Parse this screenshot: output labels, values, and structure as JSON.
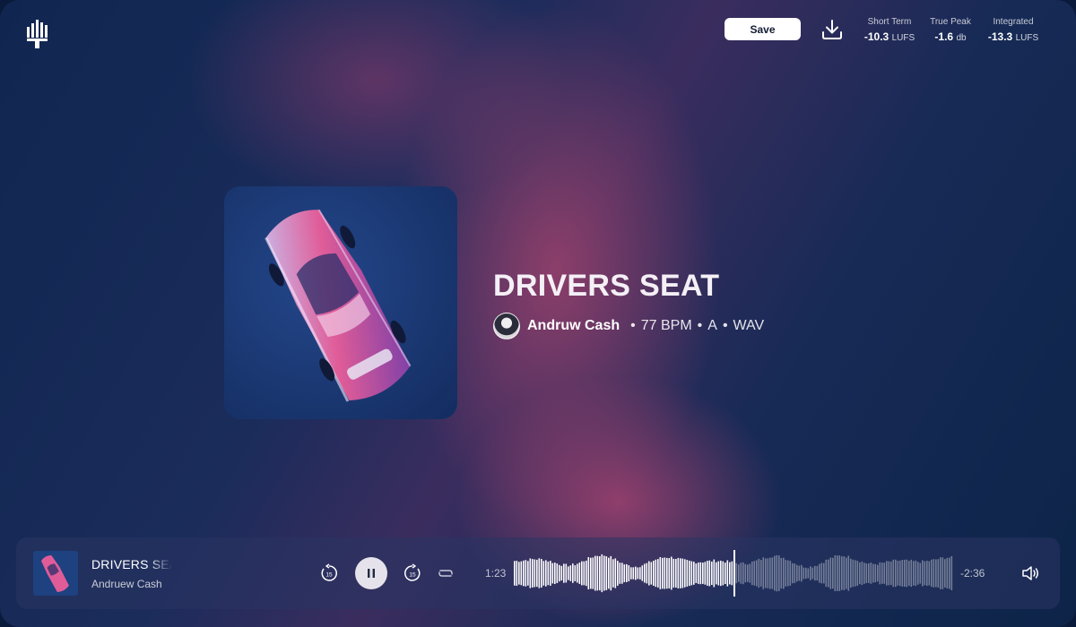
{
  "header": {
    "save_label": "Save",
    "meters": [
      {
        "label": "Short Term",
        "value": "-10.3",
        "unit": "LUFS"
      },
      {
        "label": "True Peak",
        "value": "-1.6",
        "unit": "db"
      },
      {
        "label": "Integrated",
        "value": "-13.3",
        "unit": "LUFS"
      }
    ]
  },
  "track": {
    "title": "DRIVERS SEAT",
    "artist": "Andruw Cash",
    "bpm": "77 BPM",
    "key": "A",
    "format": "WAV",
    "separator": "•"
  },
  "player": {
    "title": "DRIVERS SEAT",
    "artist": "Andruew Cash",
    "elapsed": "1:23",
    "remaining": "-2:36",
    "progress": 0.5,
    "skip_seconds": "15",
    "icons": [
      "logo-icon",
      "download-icon",
      "rewind-15-icon",
      "pause-icon",
      "forward-15-icon",
      "repeat-icon",
      "volume-icon"
    ]
  },
  "colors": {
    "accent": "#a8446e",
    "background": "#102650",
    "save_button_bg": "#ffffff",
    "cover_bg": "#1c3a76",
    "car_pink": "#e05c98"
  }
}
